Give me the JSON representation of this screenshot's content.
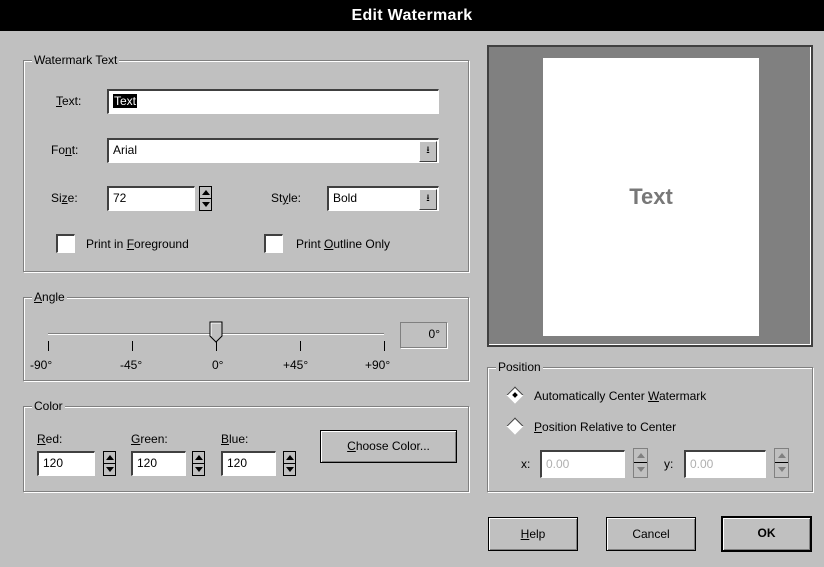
{
  "window": {
    "title": "Edit Watermark"
  },
  "watermark_text": {
    "group_title": "Watermark Text",
    "text_label": "Text:",
    "text_value": "Text",
    "font_label": "Font:",
    "font_value": "Arial",
    "size_label": "Size:",
    "size_value": "72",
    "style_label": "Style:",
    "style_value": "Bold",
    "print_foreground_label": "Print in Foreground",
    "print_outline_label": "Print Outline Only"
  },
  "angle": {
    "group_title": "Angle",
    "value": 0,
    "readout": "0°",
    "ticks": [
      "-90°",
      "-45°",
      "0°",
      "+45°",
      "+90°"
    ]
  },
  "color": {
    "group_title": "Color",
    "red_label": "Red:",
    "green_label": "Green:",
    "blue_label": "Blue:",
    "red_value": "120",
    "green_value": "120",
    "blue_value": "120",
    "choose_label": "Choose Color...",
    "rgb": "#787878"
  },
  "preview": {
    "text": "Text",
    "text_color": "#787878"
  },
  "position": {
    "group_title": "Position",
    "auto_center_label": "Automatically Center Watermark",
    "relative_label": "Position Relative to Center",
    "selected": "auto_center",
    "x_label": "x:",
    "x_value": "0.00",
    "y_label": "y:",
    "y_value": "0.00"
  },
  "buttons": {
    "help": "Help",
    "cancel": "Cancel",
    "ok": "OK"
  }
}
